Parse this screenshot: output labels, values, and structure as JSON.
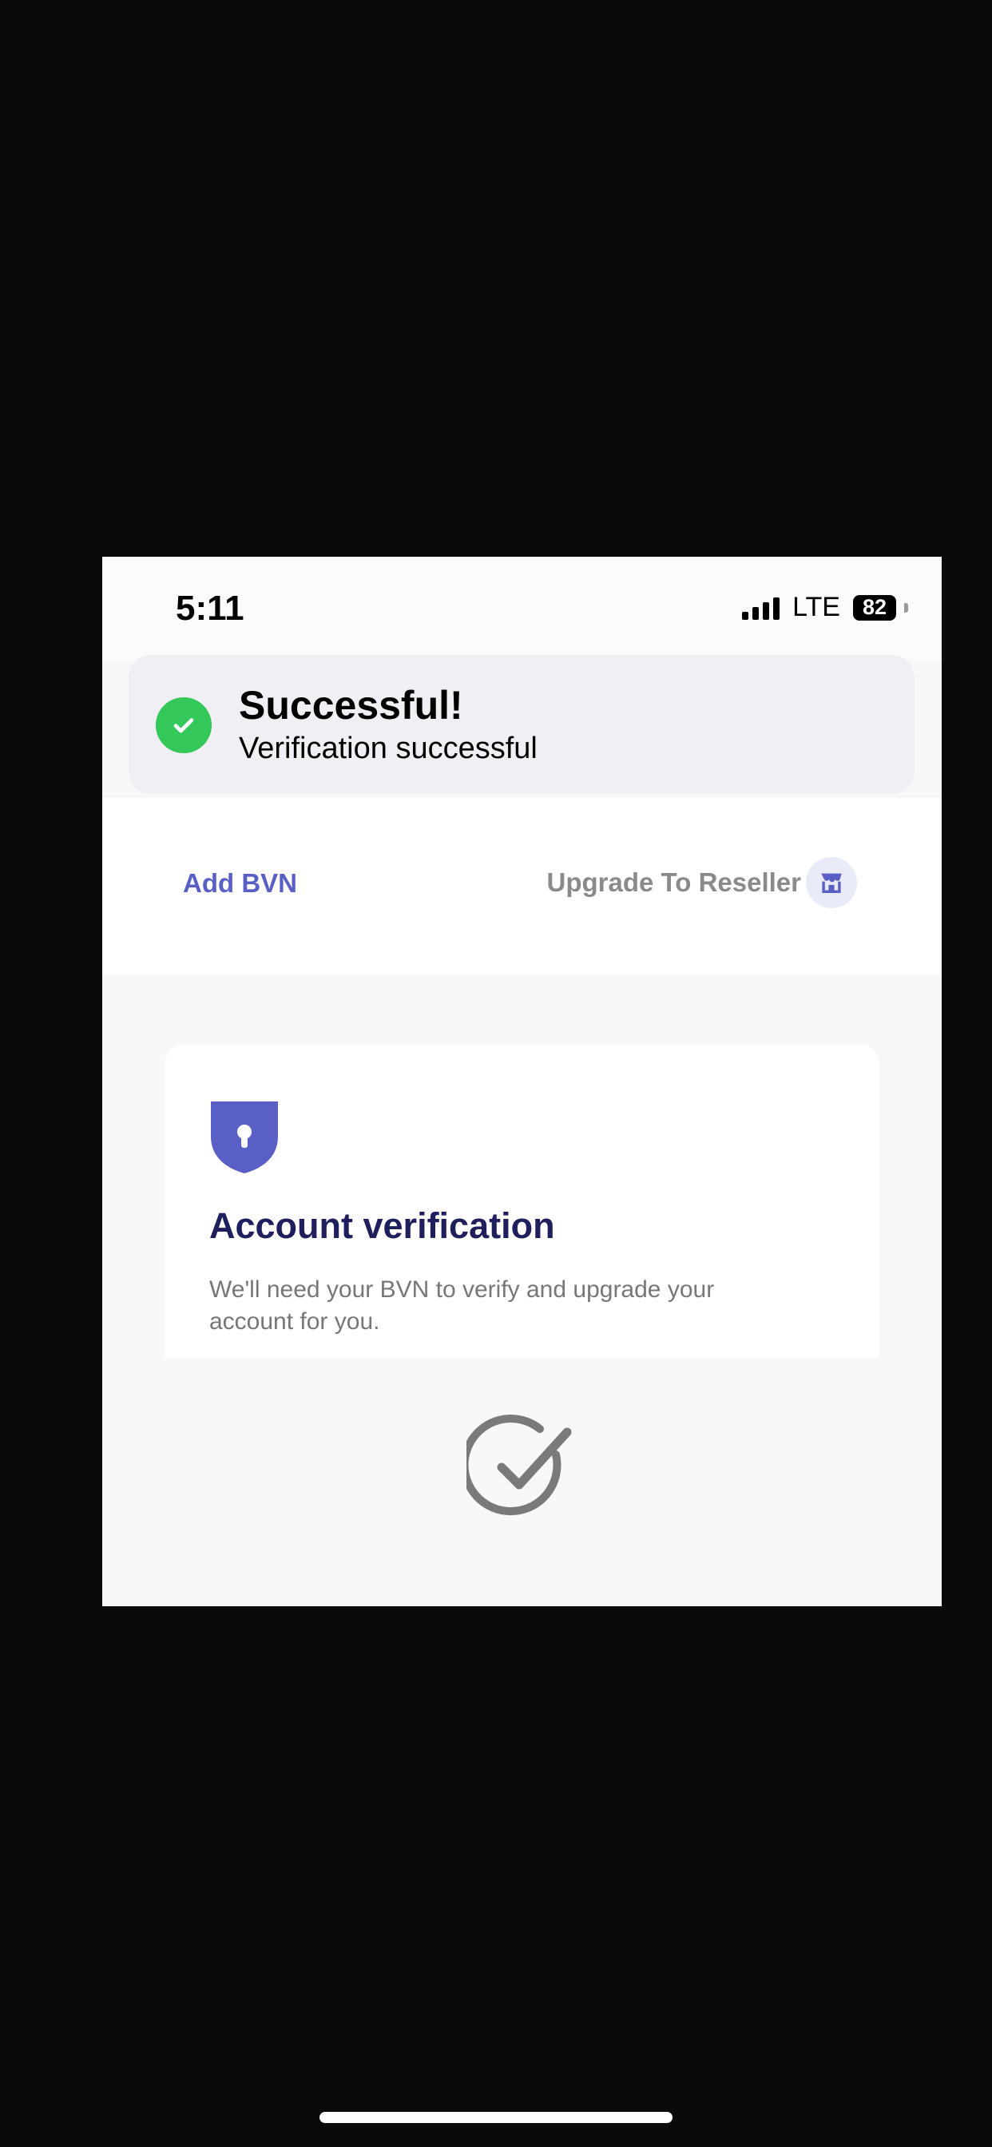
{
  "status_bar": {
    "time": "5:11",
    "network": "LTE",
    "battery": "82"
  },
  "toast": {
    "title": "Successful!",
    "message": "Verification successful",
    "icon": "check-icon",
    "color": "#34c759"
  },
  "actions": {
    "add_bvn": "Add BVN",
    "upgrade": "Upgrade To Reseller",
    "upgrade_icon": "store-icon",
    "accent": "#5a5fc6"
  },
  "card": {
    "title": "Account verification",
    "description": "We'll need your BVN to verify and upgrade your account for you.",
    "icon": "shield-lock-icon"
  },
  "confirm_icon": "check-circle-icon"
}
